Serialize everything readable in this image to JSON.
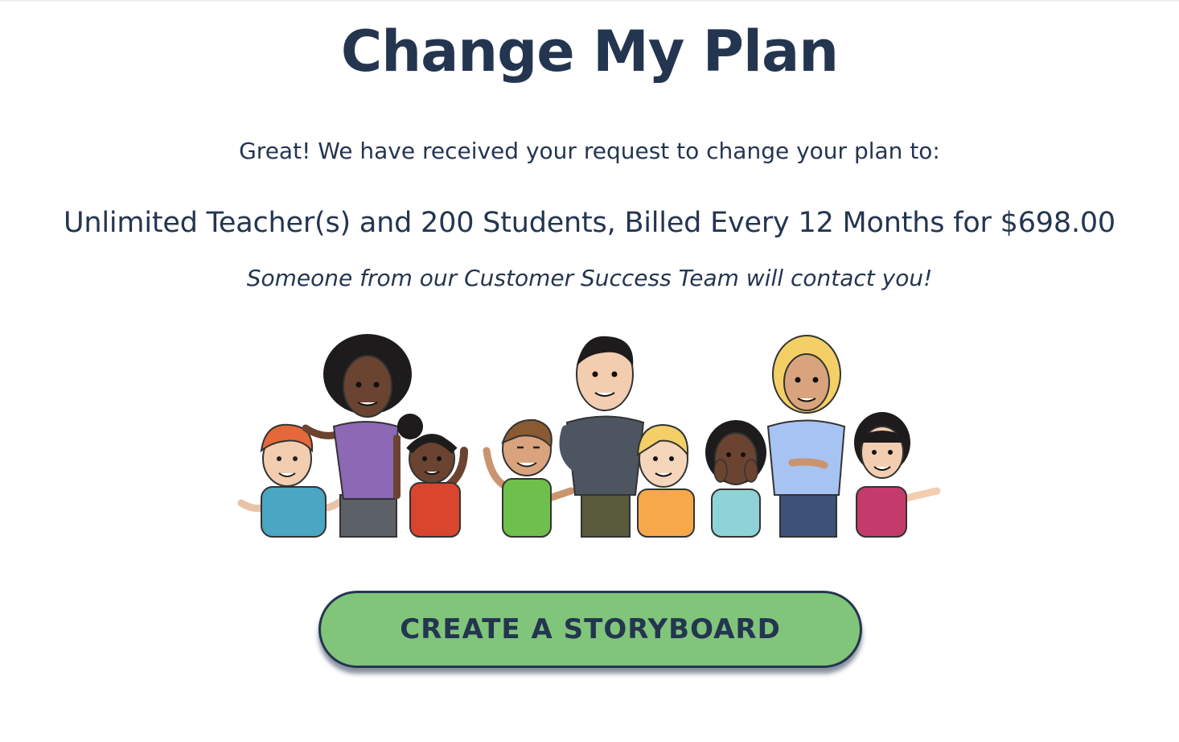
{
  "page": {
    "title": "Change My Plan",
    "confirmation_text": "Great! We have received your request to change your plan to:",
    "plan_summary": "Unlimited Teacher(s) and 200 Students, Billed Every 12 Months for $698.00",
    "contact_note": "Someone from our Customer Success Team will contact you!"
  },
  "illustration": {
    "icon": "group-of-teachers-and-students-illustration"
  },
  "cta": {
    "label": "CREATE A STORYBOARD",
    "color": "#80c57a",
    "border_color": "#243550"
  },
  "colors": {
    "text": "#243550",
    "background": "#ffffff"
  }
}
